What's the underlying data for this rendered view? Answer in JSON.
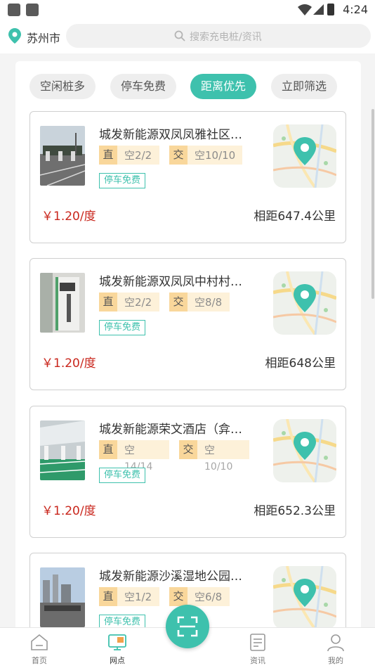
{
  "status_bar": {
    "time": "4:24"
  },
  "header": {
    "city": "苏州市",
    "search_placeholder": "搜索充电桩/资讯"
  },
  "filters": [
    {
      "label": "空闲桩多",
      "active": false
    },
    {
      "label": "停车免费",
      "active": false
    },
    {
      "label": "距离优先",
      "active": true
    },
    {
      "label": "立即筛选",
      "active": false
    }
  ],
  "stations": [
    {
      "name": "城发新能源双凤凤雅社区…",
      "dc_label": "直",
      "dc_free": "空2/2",
      "ac_label": "交",
      "ac_free": "空10/10",
      "parking": "停车免费",
      "price": "￥1.20/度",
      "distance": "相距647.4公里"
    },
    {
      "name": "城发新能源双凤凤中村村…",
      "dc_label": "直",
      "dc_free": "空2/2",
      "ac_label": "交",
      "ac_free": "空8/8",
      "parking": "停车免费",
      "price": "￥1.20/度",
      "distance": "相距648公里"
    },
    {
      "name": "城发新能源荣文酒店（弇…",
      "dc_label": "直",
      "dc_free": "空",
      "dc_free_count": "14/14",
      "ac_label": "交",
      "ac_free": "空",
      "ac_free_count": "10/10",
      "parking": "停车免费",
      "price": "￥1.20/度",
      "distance": "相距652.3公里"
    },
    {
      "name": "城发新能源沙溪湿地公园…",
      "dc_label": "直",
      "dc_free": "空1/2",
      "ac_label": "交",
      "ac_free": "空6/8",
      "parking": "停车免费"
    }
  ],
  "bottom_nav": [
    {
      "label": "首页",
      "icon": "home-icon",
      "active": false
    },
    {
      "label": "网点",
      "icon": "station-icon",
      "active": true
    },
    {
      "label": "资讯",
      "icon": "news-icon",
      "active": false
    },
    {
      "label": "我的",
      "icon": "profile-icon",
      "active": false
    }
  ],
  "colors": {
    "accent": "#3ec1ad",
    "price": "#c9261c",
    "tag_bg": "#fdf1d9",
    "tag_type_bg": "#f9d79b"
  }
}
